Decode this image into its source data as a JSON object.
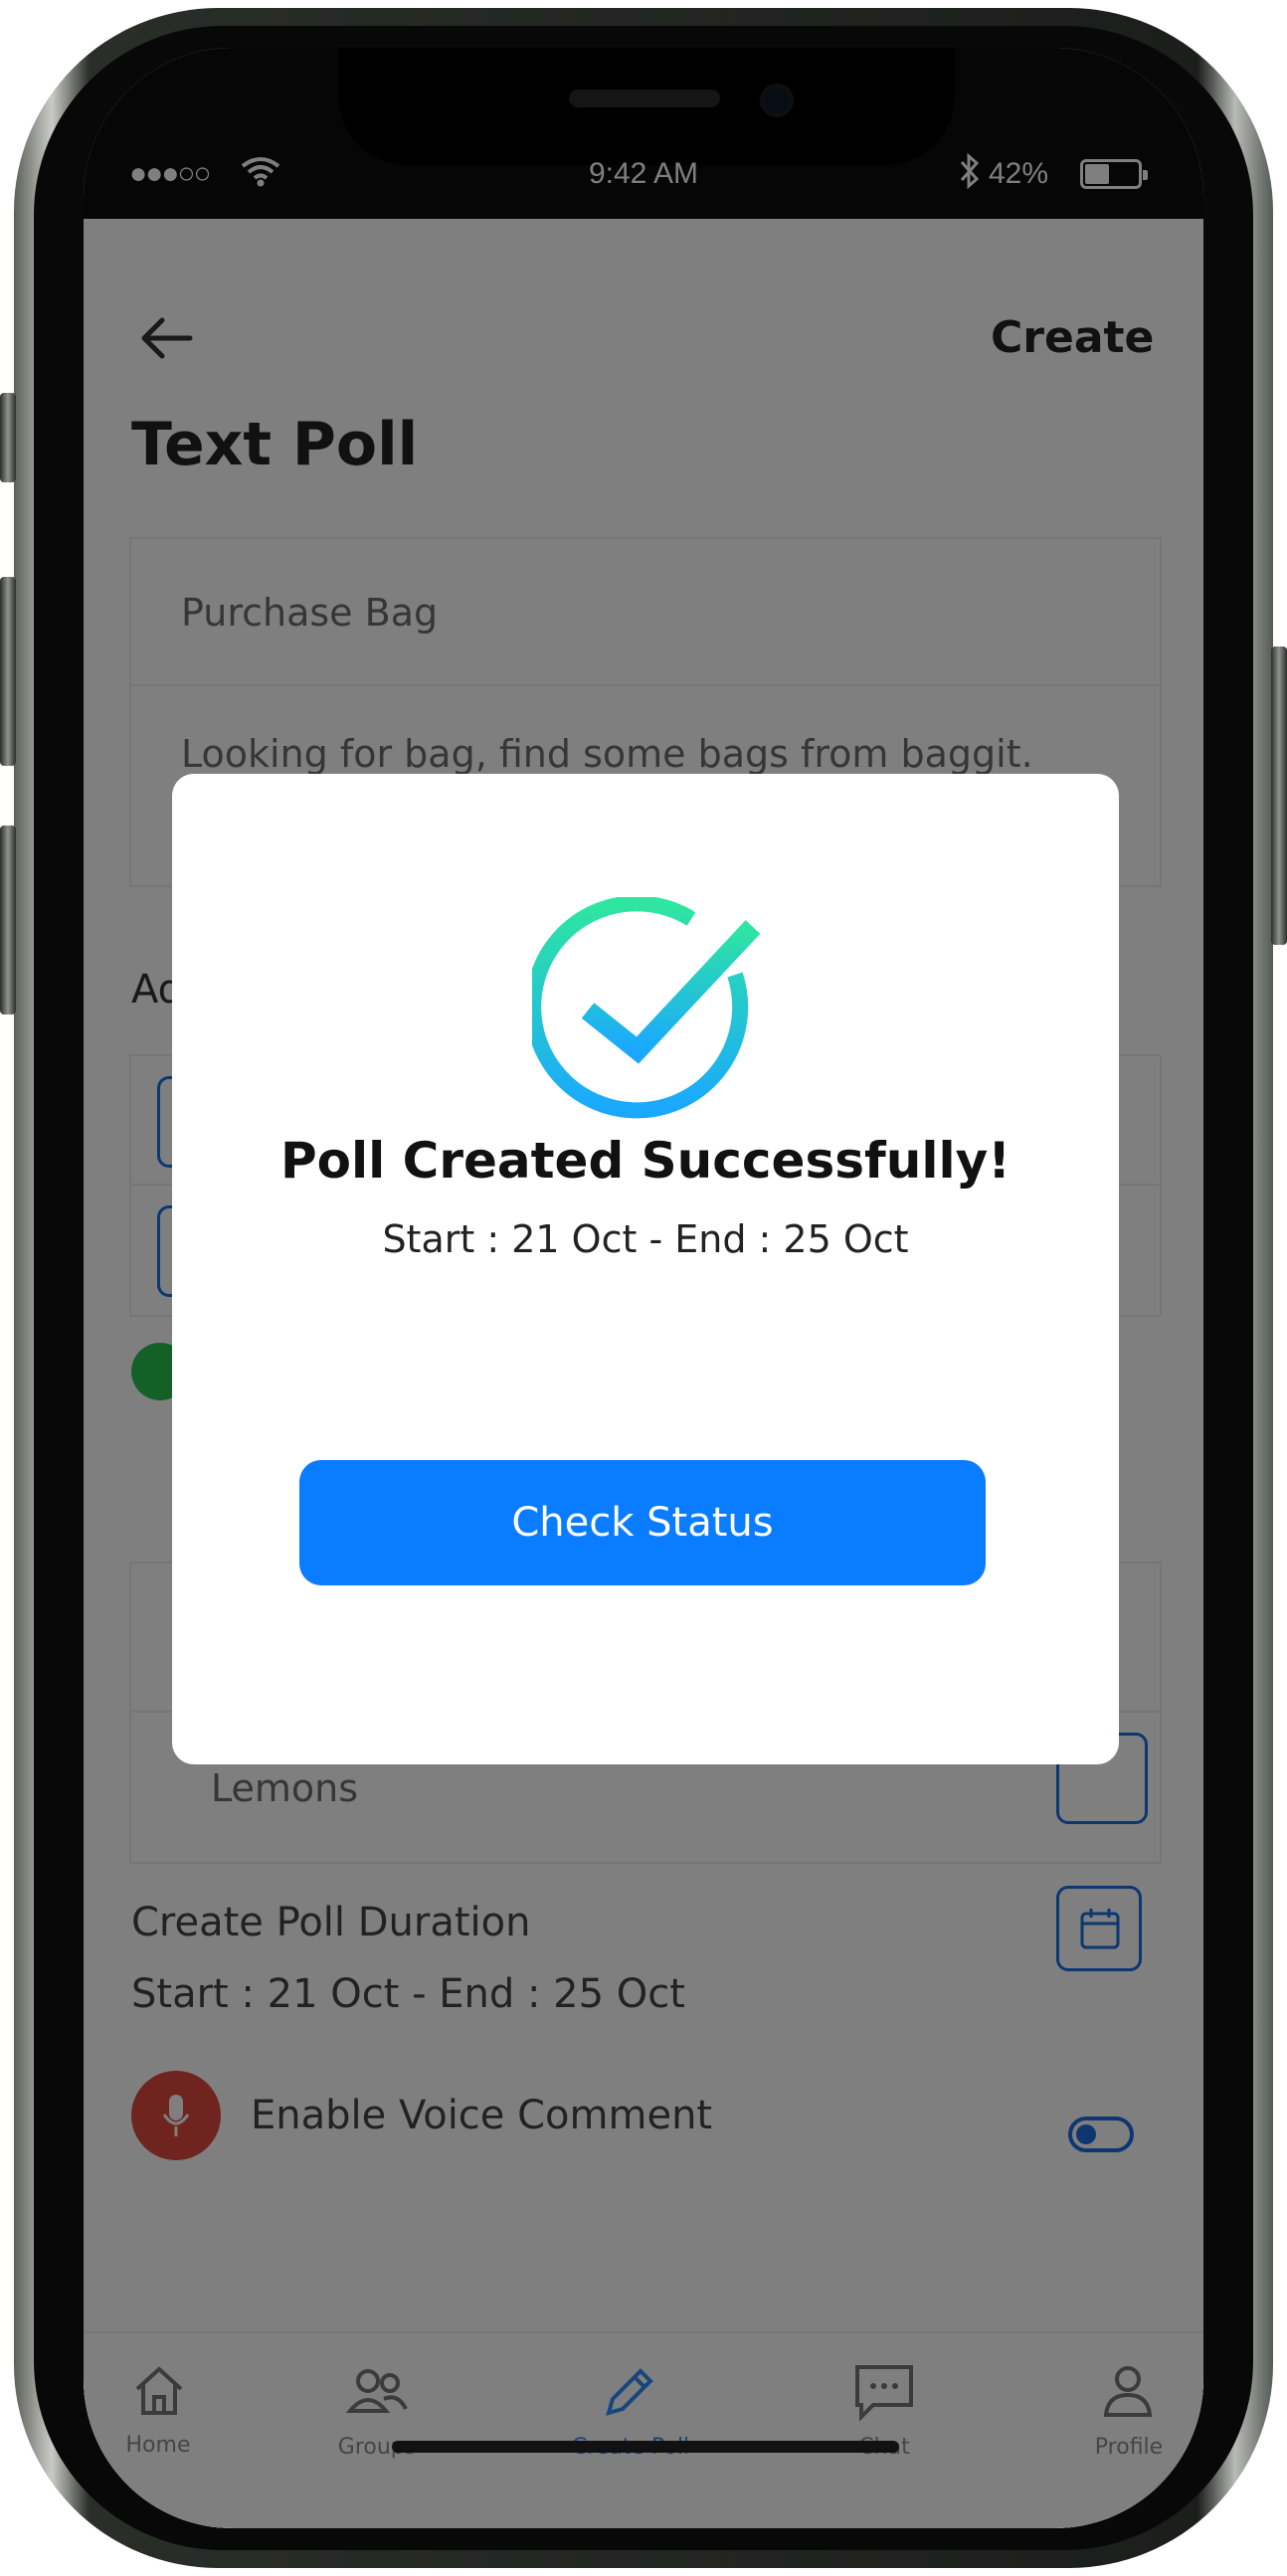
{
  "status_bar": {
    "signal": "●●●○○",
    "time": "9:42 AM",
    "battery_percent": "42%"
  },
  "header": {
    "title": "Text Poll",
    "create_label": "Create"
  },
  "form": {
    "question_title": "Purchase Bag",
    "description": "Looking for bag, find some bags from baggit.",
    "add_options_partial": "Ad",
    "options_label_partial": "Lemons"
  },
  "duration": {
    "heading": "Create Poll Duration",
    "range": "Start : 21 Oct - End : 25 Oct"
  },
  "voice": {
    "label": "Enable Voice Comment",
    "enabled": true
  },
  "bottom_nav": {
    "items": [
      {
        "label": "Home",
        "icon": "home-icon"
      },
      {
        "label": "Groups",
        "icon": "groups-icon"
      },
      {
        "label": "Create Poll",
        "icon": "pencil-icon",
        "active": true
      },
      {
        "label": "Chat",
        "icon": "chat-icon"
      },
      {
        "label": "Profile",
        "icon": "profile-icon"
      }
    ]
  },
  "modal": {
    "icon": "check-circle-icon",
    "title": "Poll Created Successfully!",
    "date_range": "Start : 21 Oct - End : 25 Oct",
    "button_label": "Check Status"
  },
  "colors": {
    "accent": "#0a7cff",
    "check_gradient_start": "#2ee6a0",
    "check_gradient_end": "#1aa8ff"
  }
}
